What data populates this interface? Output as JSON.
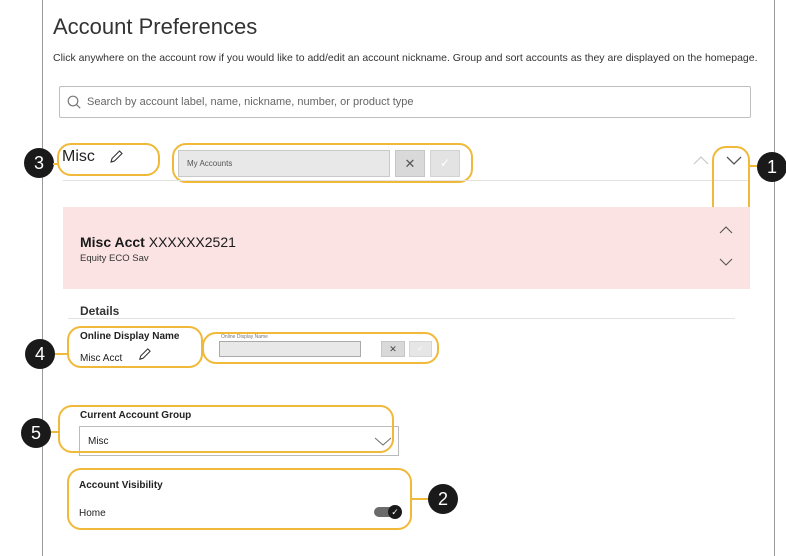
{
  "page": {
    "title": "Account Preferences",
    "subtitle": "Click anywhere on the account row if you would like to add/edit an account nickname. Group and sort accounts as they are displayed on the homepage."
  },
  "search": {
    "placeholder": "Search by account label, name, nickname, number, or product type"
  },
  "group_header": {
    "name": "Misc",
    "edit_value": "My Accounts",
    "cancel_label": "✕",
    "confirm_label": "✓"
  },
  "account": {
    "name": "Misc Acct",
    "number": "XXXXXX2521",
    "product": "Equity ECO Sav"
  },
  "details": {
    "heading": "Details",
    "online_display_name_label": "Online Display Name",
    "online_display_name_value": "Misc Acct",
    "online_display_name_placeholder": "Online Display Name",
    "cancel_label": "✕",
    "confirm_label": "✓",
    "current_group_label": "Current Account Group",
    "current_group_value": "Misc",
    "visibility_label": "Account Visibility",
    "visibility_option": "Home",
    "visibility_on": true
  },
  "callouts": [
    "1",
    "2",
    "3",
    "4",
    "5"
  ],
  "icons": {
    "search": "search-icon",
    "pencil": "pencil-icon",
    "chevron_up": "chevron-up-icon",
    "chevron_down": "chevron-down-icon",
    "check": "check-icon"
  },
  "colors": {
    "highlight": "#f1b93a",
    "account_band": "#fbe3e4",
    "callout": "#1a1a1a"
  }
}
